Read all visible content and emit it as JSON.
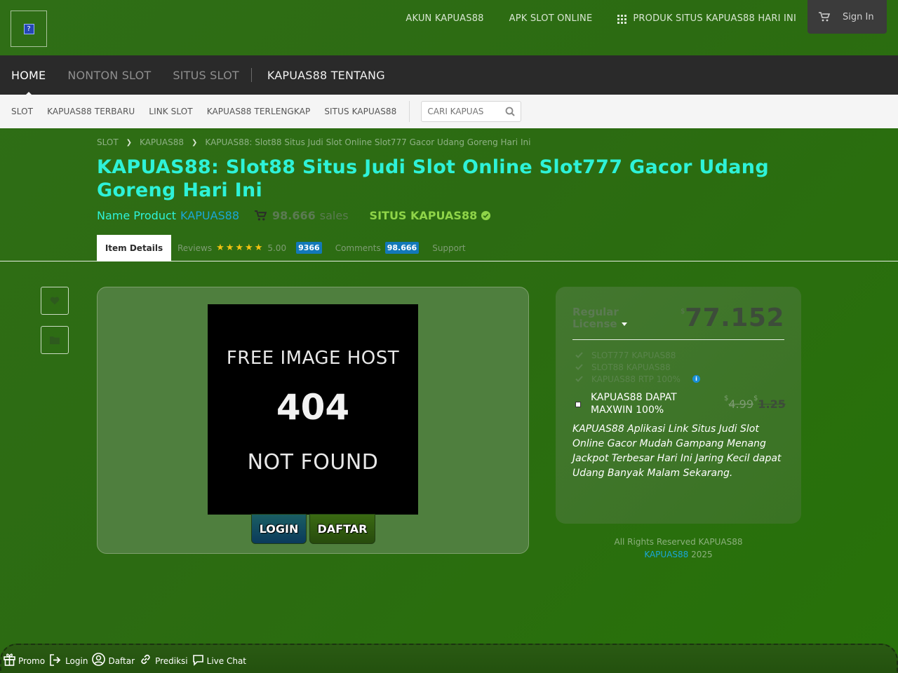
{
  "logo": {
    "glyph": "?"
  },
  "topnav": {
    "items": [
      "AKUN KAPUAS88",
      "APK SLOT ONLINE",
      "PRODUK SITUS KAPUAS88 HARI INI"
    ],
    "signin": "Sign In"
  },
  "mainnav": {
    "items": [
      "HOME",
      "NONTON SLOT",
      "SITUS SLOT",
      "KAPUAS88 TENTANG"
    ]
  },
  "subnav": {
    "items": [
      "SLOT",
      "KAPUAS88 TERBARU",
      "LINK SLOT",
      "KAPUAS88 TERLENGKAP",
      "SITUS KAPUAS88"
    ],
    "search_placeholder": "CARI KAPUAS"
  },
  "breadcrumb": [
    "SLOT",
    "KAPUAS88",
    "KAPUAS88: Slot88 Situs Judi Slot Online Slot777 Gacor Udang Goreng Hari Ini"
  ],
  "title": "KAPUAS88: Slot88 Situs Judi Slot Online Slot777 Gacor Udang Goreng Hari Ini",
  "meta": {
    "name_product_label": "Name Product",
    "name_product_link": "KAPUAS88",
    "sales_count": "98.666",
    "sales_word": "sales",
    "situs": "SITUS KAPUAS88"
  },
  "tabs": {
    "item_details": "Item Details",
    "reviews_label": "Reviews",
    "rating": "5.00",
    "reviews_count": "9366",
    "comments_label": "Comments",
    "comments_count": "98.666",
    "support": "Support"
  },
  "image": {
    "line1": "FREE IMAGE HOST",
    "line2": "404",
    "line3": "NOT FOUND"
  },
  "buttons": {
    "login": "LOGIN",
    "daftar": "DAFTAR"
  },
  "pricing": {
    "license_line1": "Regular",
    "license_line2": "License",
    "currency": "$",
    "price": "77.152",
    "features": [
      "SLOT777 KAPUAS88",
      "SLOT88 KAPUAS88",
      "KAPUAS88 RTP 100%"
    ],
    "addon_label": "KAPUAS88 DAPAT MAXWIN 100%",
    "addon_old_price": "4.99",
    "addon_new_price": "1.25",
    "description": "KAPUAS88 Aplikasi Link Situs Judi Slot Online Gacor Mudah Gampang Menang Jackpot Terbesar Hari Ini Jaring Kecil dapat Udang Banyak Malam Sekarang."
  },
  "footer": {
    "rights": "All Rights Reserved KAPUAS88",
    "brand": "KAPUAS88",
    "year": "2025"
  },
  "bottombar": {
    "items": [
      "Promo",
      "Login",
      "Daftar",
      "Prediksi",
      "Live Chat"
    ]
  },
  "colors": {
    "title": "#2ef2d8",
    "link": "#1aa7d6",
    "situs_green": "#8fd448",
    "badge_blue": "#1379b9",
    "star": "#f3c312"
  }
}
